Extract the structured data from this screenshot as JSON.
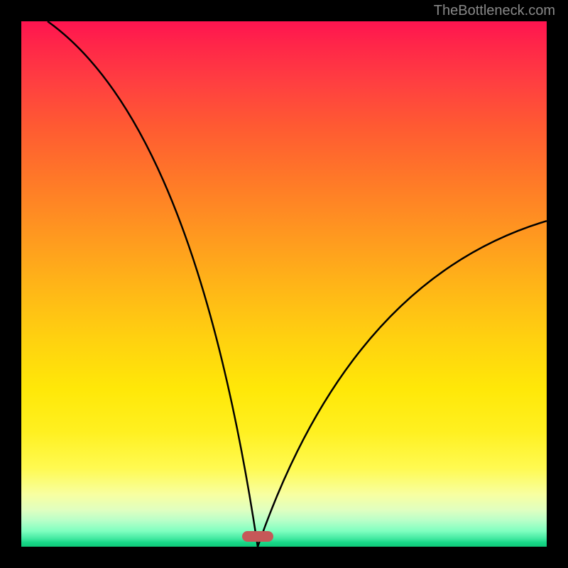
{
  "watermark": "TheBottleneck.com",
  "chart_data": {
    "type": "line",
    "title": "",
    "xlabel": "",
    "ylabel": "",
    "xlim": [
      0,
      100
    ],
    "ylim": [
      0,
      100
    ],
    "curve_description": "V-shaped bottleneck curve showing deviation from optimal configuration",
    "minimum_point": {
      "x": 45,
      "y": 0
    },
    "left_branch": {
      "start": {
        "x": 5,
        "y": 100
      },
      "end": {
        "x": 45,
        "y": 0
      },
      "shape": "concave decreasing"
    },
    "right_branch": {
      "start": {
        "x": 45,
        "y": 0
      },
      "end": {
        "x": 100,
        "y": 62
      },
      "shape": "concave increasing"
    },
    "marker": {
      "x": 45,
      "y": 2,
      "width": 6,
      "height": 2
    },
    "background_gradient": {
      "top": "#ff1450",
      "middle": "#ffd010",
      "bottom": "#10c878",
      "meaning": "red=high bottleneck, green=optimal"
    }
  },
  "colors": {
    "frame": "#000000",
    "curve": "#000000",
    "marker": "#c65858",
    "watermark": "#888888"
  }
}
